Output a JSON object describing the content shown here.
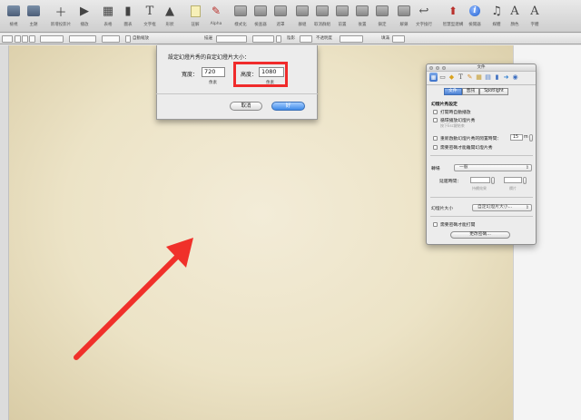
{
  "toolbar": {
    "items": [
      {
        "label": "檢視",
        "icon": "view-icon"
      },
      {
        "label": "主題",
        "icon": "theme-icon"
      },
      {
        "label": "新增投影片",
        "icon": "new-slide-icon"
      },
      {
        "label": "播放",
        "icon": "play-icon"
      },
      {
        "label": "表格",
        "icon": "table-icon"
      },
      {
        "label": "圖表",
        "icon": "chart-icon"
      },
      {
        "label": "文字框",
        "icon": "text-box-icon"
      },
      {
        "label": "形狀",
        "icon": "shape-icon"
      },
      {
        "label": "註解",
        "icon": "comment-icon"
      },
      {
        "label": "Alpha",
        "icon": "alpha-icon"
      },
      {
        "label": "樣式化",
        "icon": "style-icon"
      },
      {
        "label": "檢查器",
        "icon": "inspector-icon"
      },
      {
        "label": "遮罩",
        "icon": "mask-icon"
      },
      {
        "label": "群組",
        "icon": "group-icon"
      },
      {
        "label": "取消群組",
        "icon": "ungroup-icon"
      },
      {
        "label": "前置",
        "icon": "front-icon"
      },
      {
        "label": "後置",
        "icon": "back-icon"
      },
      {
        "label": "鎖定",
        "icon": "lock-icon"
      },
      {
        "label": "解鎖",
        "icon": "unlock-icon"
      },
      {
        "label": "文字換行",
        "icon": "wrap-icon"
      },
      {
        "label": "智慧型建構",
        "icon": "smart-build-icon"
      },
      {
        "label": "檢閱器",
        "icon": "info-icon"
      },
      {
        "label": "媒體",
        "icon": "media-icon"
      },
      {
        "label": "顏色",
        "icon": "colors-icon"
      },
      {
        "label": "字體",
        "icon": "fonts-icon"
      }
    ]
  },
  "formatbar": {
    "checkbox_label": "自動縮放",
    "stroke_label": "描邊",
    "opacity_label": "陰影",
    "opacity_value": "不透明度",
    "fill_label": "填滿"
  },
  "dialog": {
    "title": "設定幻燈片秀的自定幻燈片大小：",
    "width_label": "寬度：",
    "width_value": "720",
    "width_unit": "像素",
    "height_label": "高度：",
    "height_value": "1080",
    "height_unit": "像素",
    "cancel_label": "取消",
    "ok_label": "好",
    "highlight_color": "#f02b2b"
  },
  "inspector": {
    "title": "文件",
    "tabs": [
      "文件",
      "音訊",
      "Spotlight"
    ],
    "section1_title": "幻燈片秀設定",
    "opt_auto_play": "打開時自動播放",
    "opt_loop": "循環播放幻燈片秀",
    "opt_loop_hint": "按下Esc鍵結束",
    "opt_restart": "重新啟動幻燈片秀的閒置時間：",
    "restart_value": "15",
    "restart_unit": "m",
    "opt_password_exit": "需要密碼才能離開幻燈片秀",
    "section2_label": "轉場",
    "transition_select": "一般",
    "delay_label": "延遲時間：",
    "duration_label": "持續效果",
    "direction_label": "欄片",
    "size_label": "幻燈片大小",
    "size_select": "自定幻燈片大小...",
    "opt_password_open": "需要密碼才能打開",
    "change_password_button": "更改密碼..."
  },
  "colors": {
    "arrow": "#f0302a",
    "slide_bg": "#ece3c6"
  }
}
